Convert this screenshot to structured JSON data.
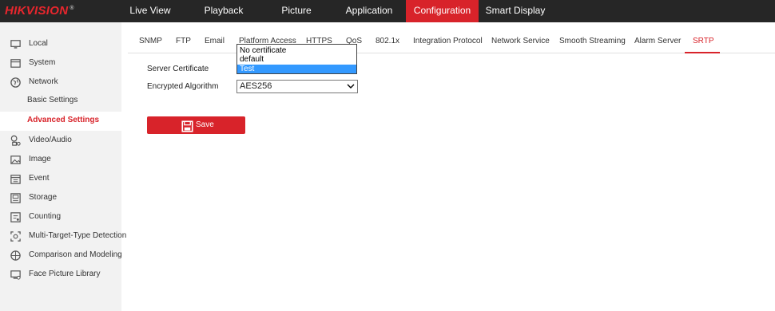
{
  "brand": {
    "name": "HIKVISION",
    "mark": "®"
  },
  "nav": [
    {
      "label": "Live View"
    },
    {
      "label": "Playback"
    },
    {
      "label": "Picture"
    },
    {
      "label": "Application"
    },
    {
      "label": "Configuration",
      "active": true
    },
    {
      "label": "Smart Display"
    }
  ],
  "sidebar": {
    "items": [
      {
        "label": "Local",
        "icon": "monitor-icon"
      },
      {
        "label": "System",
        "icon": "system-icon"
      },
      {
        "label": "Network",
        "icon": "globe-icon"
      },
      {
        "label": "Basic Settings",
        "sub": true
      },
      {
        "label": "Advanced Settings",
        "sub": true,
        "active": true
      },
      {
        "label": "Video/Audio",
        "icon": "camera-mic-icon"
      },
      {
        "label": "Image",
        "icon": "image-icon"
      },
      {
        "label": "Event",
        "icon": "calendar-icon"
      },
      {
        "label": "Storage",
        "icon": "storage-icon"
      },
      {
        "label": "Counting",
        "icon": "counting-icon"
      },
      {
        "label": "Multi-Target-Type Detection",
        "icon": "detection-icon"
      },
      {
        "label": "Comparison and Modeling",
        "icon": "comparison-icon"
      },
      {
        "label": "Face Picture Library",
        "icon": "face-library-icon"
      }
    ]
  },
  "tabs": [
    {
      "label": "SNMP"
    },
    {
      "label": "FTP"
    },
    {
      "label": "Email"
    },
    {
      "label": "Platform Access"
    },
    {
      "label": "HTTPS"
    },
    {
      "label": "QoS"
    },
    {
      "label": "802.1x"
    },
    {
      "label": "Integration Protocol"
    },
    {
      "label": "Network Service"
    },
    {
      "label": "Smooth Streaming"
    },
    {
      "label": "Alarm Server"
    },
    {
      "label": "SRTP",
      "active": true
    }
  ],
  "form": {
    "server_certificate": {
      "label": "Server Certificate",
      "options": [
        "No certificate",
        "default",
        "Test"
      ],
      "highlighted": "Test"
    },
    "encrypted_algorithm": {
      "label": "Encrypted Algorithm",
      "value": "AES256"
    },
    "save_label": "Save"
  },
  "colors": {
    "accent": "#d8232a",
    "topbar": "#262626",
    "sidebar": "#f2f2f2",
    "highlight": "#3399ff"
  }
}
